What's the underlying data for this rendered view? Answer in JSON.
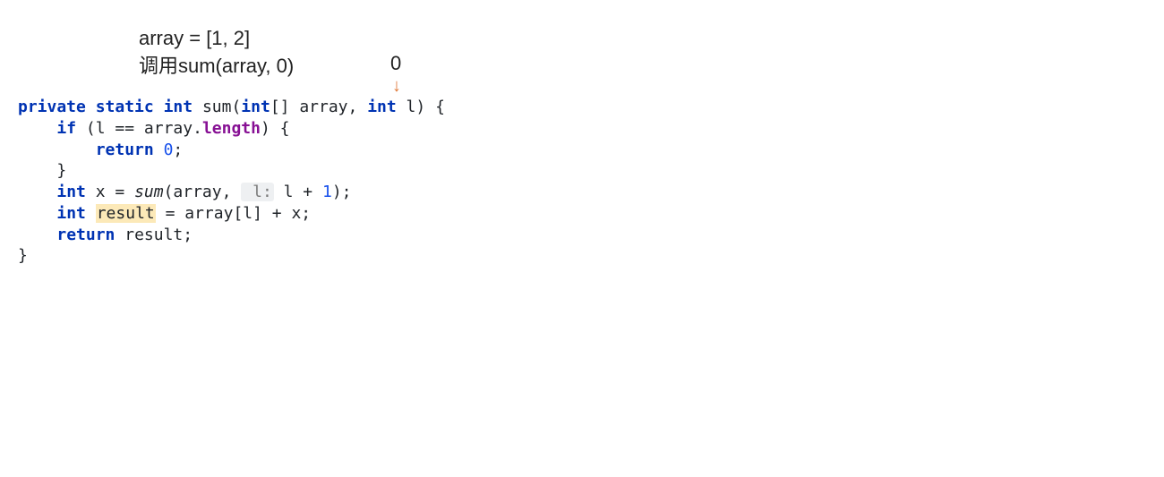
{
  "annotation": {
    "line1": "array = [1, 2]",
    "line2": "调用sum(array, 0)",
    "zero_label": "0"
  },
  "arrow_glyph": "↓",
  "code": {
    "kw_private": "private",
    "kw_static": "static",
    "kw_int": "int",
    "fn_sum_decl": "sum",
    "param_open": "(",
    "kw_int_arr": "int",
    "arr_brackets": "[]",
    "param_array": " array, ",
    "kw_int_l": "int",
    "param_l": " l) {",
    "kw_if": "if",
    "cond_open": " (l == array.",
    "kw_length": "length",
    "cond_close": ") {",
    "kw_return1": "return",
    "zero_lit": " 0",
    "semi": ";",
    "brace_close": "}",
    "kw_int_x": "int",
    "assign_x": " x = ",
    "fn_sum_call": "sum",
    "call_open": "(array, ",
    "hint_l": " l:",
    "expr_l": " l + ",
    "one_lit": "1",
    "call_close": ");",
    "kw_int_res": "int",
    "sp": " ",
    "var_result": "result",
    "assign_res": " = array[l] + x;",
    "kw_return2": "return",
    "ret_expr": " result;",
    "final_brace": "}"
  }
}
